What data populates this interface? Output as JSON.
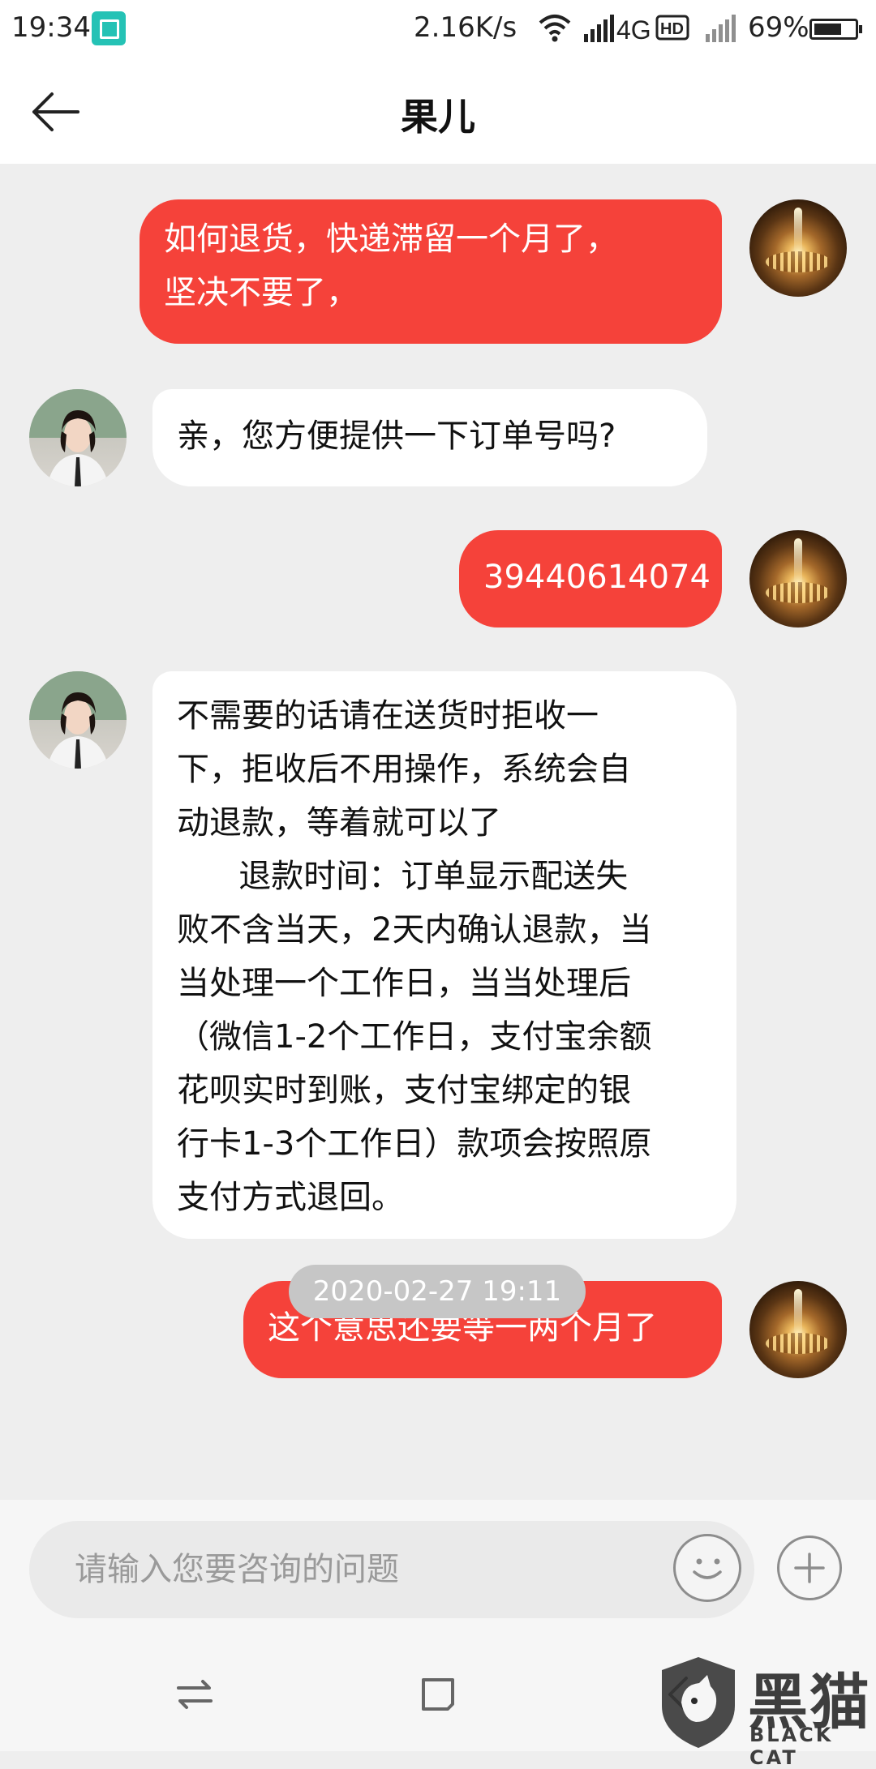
{
  "status_bar": {
    "time": "19:34",
    "network_speed": "2.16K/s",
    "network_type": "4G",
    "hd_label": "HD",
    "battery_percent": "69%",
    "battery_level": 0.69,
    "icons": [
      "scan-icon",
      "wifi-icon",
      "signal-icon",
      "hd-icon",
      "signal-icon",
      "battery-icon"
    ]
  },
  "header": {
    "title": "果儿"
  },
  "messages": [
    {
      "side": "sent",
      "text": "如何退货，快递滞留一个月了，\n坚决不要了，"
    },
    {
      "side": "received",
      "text": "亲，您方便提供一下订单号吗?"
    },
    {
      "side": "sent",
      "text": "39440614074"
    },
    {
      "side": "received",
      "text": "不需要的话请在送货时拒收一\n下，拒收后不用操作，系统会自\n动退款，等着就可以了\n      退款时间：订单显示配送失\n败不含当天，2天内确认退款，当\n当处理一个工作日，当当处理后\n（微信1-2个工作日，支付宝余额\n花呗实时到账，支付宝绑定的银\n行卡1-3个工作日）款项会按照原\n支付方式退回。"
    },
    {
      "side": "sent",
      "text": "这个意思还要等一两个月了"
    }
  ],
  "timestamp": "2020-02-27 19:11",
  "input": {
    "placeholder": "请输入您要咨询的问题",
    "value": ""
  },
  "watermark": {
    "text": "黑猫",
    "sub": "BLACK CAT"
  },
  "colors": {
    "sent_bubble": "#f5423a",
    "received_bubble": "#ffffff",
    "chat_background": "#eeeeee"
  }
}
